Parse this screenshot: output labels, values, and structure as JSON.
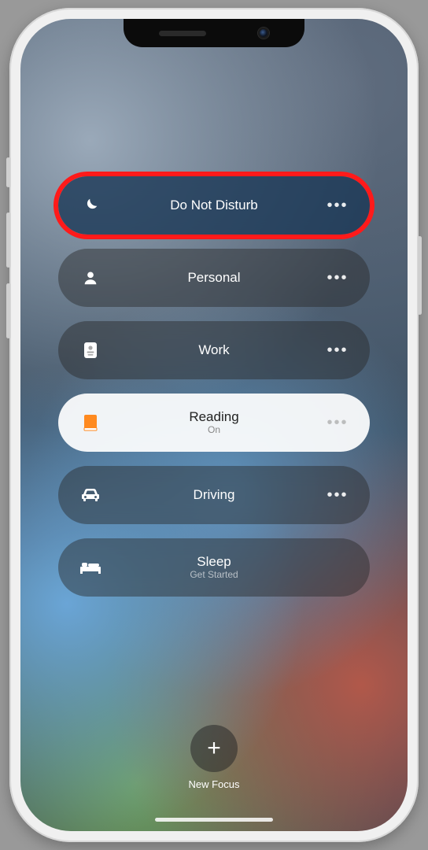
{
  "focus_modes": [
    {
      "id": "dnd",
      "label": "Do Not Disturb",
      "sub": "",
      "icon": "moon",
      "style": "blue",
      "more": true,
      "highlight": true
    },
    {
      "id": "personal",
      "label": "Personal",
      "sub": "",
      "icon": "person",
      "style": "dark",
      "more": true,
      "highlight": false
    },
    {
      "id": "work",
      "label": "Work",
      "sub": "",
      "icon": "badge",
      "style": "dark",
      "more": true,
      "highlight": false
    },
    {
      "id": "reading",
      "label": "Reading",
      "sub": "On",
      "icon": "book",
      "style": "light",
      "more": true,
      "highlight": false
    },
    {
      "id": "driving",
      "label": "Driving",
      "sub": "",
      "icon": "car",
      "style": "dark",
      "more": true,
      "highlight": false
    },
    {
      "id": "sleep",
      "label": "Sleep",
      "sub": "Get Started",
      "icon": "bed",
      "style": "dark",
      "more": false,
      "highlight": false
    }
  ],
  "more_glyph": "•••",
  "new_focus": {
    "label": "New Focus",
    "plus": "+"
  },
  "icon_color_reading": "#ff8a1f"
}
